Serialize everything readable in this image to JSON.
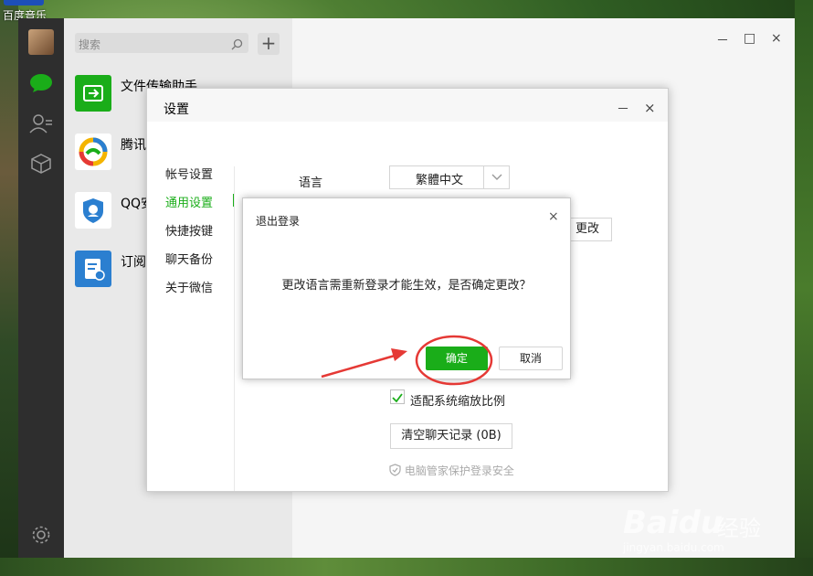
{
  "desktop": {
    "icon_label": "百度音乐"
  },
  "wechat": {
    "search_placeholder": "搜索",
    "add_symbol": "+",
    "chats": [
      {
        "name": "文件传输助手",
        "icon_color": "#1aad19"
      },
      {
        "name": "腾讯",
        "icon_color": "#ffffff"
      },
      {
        "name": "QQ安",
        "icon_color": "#ffffff"
      },
      {
        "name": "订阅",
        "icon_color": "#2b7fd0"
      }
    ],
    "window_controls": {
      "minimize": "－",
      "maximize": "□",
      "close": "×"
    }
  },
  "settings": {
    "title": "设置",
    "controls": {
      "minimize": "－",
      "close": "×"
    },
    "nav": [
      "帐号设置",
      "通用设置",
      "快捷按键",
      "聊天备份",
      "关于微信"
    ],
    "active_index": 1,
    "language_label": "语言",
    "language_value": "繁體中文",
    "change_button": "更改",
    "scale_checkbox_label": "适配系统缩放比例",
    "scale_checked": true,
    "clear_button": "清空聊天记录 (0B)",
    "guard_text": "电脑管家保护登录安全"
  },
  "modal": {
    "title": "退出登录",
    "close": "×",
    "message": "更改语言需重新登录才能生效，是否确定更改？",
    "ok": "确定",
    "cancel": "取消"
  },
  "colors": {
    "accent": "#1aad19",
    "annotation": "#e53935"
  },
  "watermark": {
    "logo": "Baidu",
    "cn": "经验",
    "url": "jingyan.baidu.com"
  }
}
